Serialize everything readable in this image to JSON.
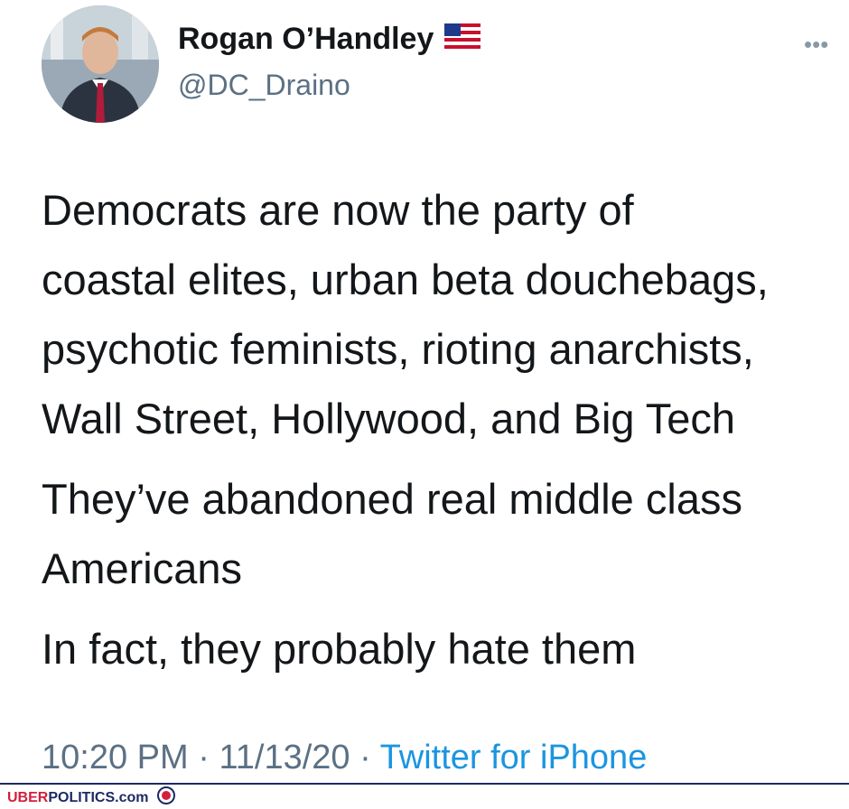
{
  "author": {
    "display_name": "Rogan O’Handley",
    "handle": "@DC_Draino",
    "flag_icon": "us-flag-icon"
  },
  "menu": {
    "more_label": "•••"
  },
  "tweet": {
    "paragraphs": [
      "Democrats are now the party of\ncoastal elites, urban beta douchebags,\npsychotic feminists, rioting anarchists,\nWall Street, Hollywood, and Big Tech",
      "They’ve abandoned real middle class\nAmericans",
      "In fact, they probably hate them"
    ],
    "time": "10:20 PM",
    "date": "11/13/20",
    "separator": " · ",
    "source": "Twitter for iPhone"
  },
  "watermark": {
    "brand_red": "UBER",
    "brand_blue": "POLITICS.com"
  },
  "colors": {
    "text": "#14171a",
    "secondary": "#5b7083",
    "link": "#1b95e0",
    "brand_red": "#d21f3c",
    "brand_blue": "#1c2a63"
  }
}
